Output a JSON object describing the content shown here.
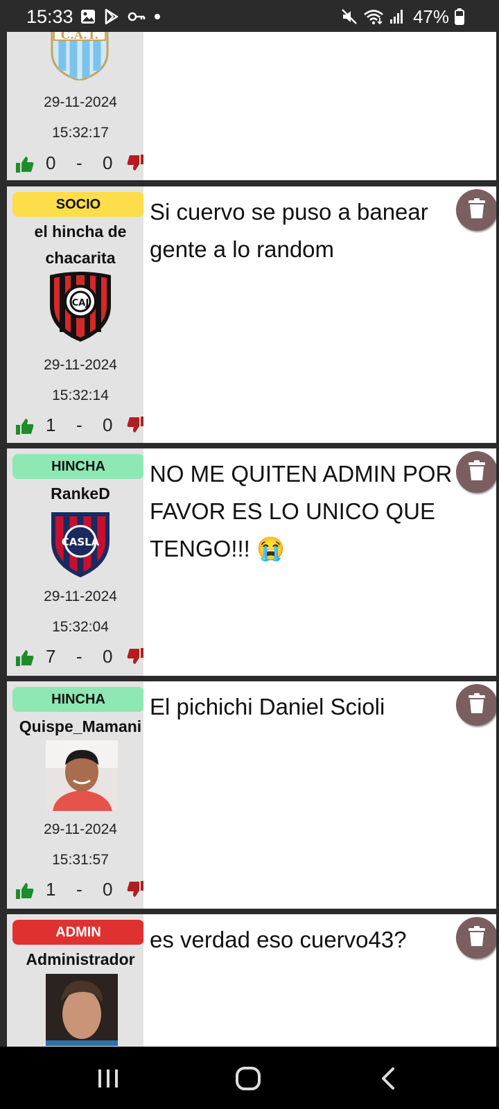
{
  "status_bar": {
    "time": "15:33",
    "battery": "47%",
    "icons": [
      "gallery-icon",
      "play-store-icon",
      "key-icon",
      "dot-icon",
      "mute-icon",
      "wifi-icon",
      "signal-icon",
      "battery-icon"
    ]
  },
  "posts": [
    {
      "date": "29-11-2024",
      "time": "15:32:17",
      "likes": "0",
      "separator": "-",
      "dislikes": "0",
      "avatar_text": "C.A.T.",
      "message": ""
    },
    {
      "role": "SOCIO",
      "role_color": "#fddd4a",
      "username": "el hincha de chacarita",
      "date": "29-11-2024",
      "time": "15:32:14",
      "likes": "1",
      "separator": "-",
      "dislikes": "0",
      "message": "Si cuervo se puso a banear gente a lo random"
    },
    {
      "role": "HINCHA",
      "role_color": "#8ee8b3",
      "username": "RankeD",
      "date": "29-11-2024",
      "time": "15:32:04",
      "likes": "7",
      "separator": "-",
      "dislikes": "0",
      "message": "NO ME QUITEN ADMIN POR FAVOR ES LO UNICO QUE TENGO!!! 😭"
    },
    {
      "role": "HINCHA",
      "role_color": "#8ee8b3",
      "username": "Quispe_Mamani",
      "date": "29-11-2024",
      "time": "15:31:57",
      "likes": "1",
      "separator": "-",
      "dislikes": "0",
      "message": "El pichichi Daniel Scioli"
    },
    {
      "role": "ADMIN",
      "role_color": "#e03131",
      "username": "Administrador",
      "message": "es verdad eso cuervo43?"
    }
  ],
  "colors": {
    "like": "#1e8c2a",
    "dislike": "#b21e1e",
    "trash_bg": "#7b5e5f",
    "sidebar_bg": "#e3e3e3"
  }
}
